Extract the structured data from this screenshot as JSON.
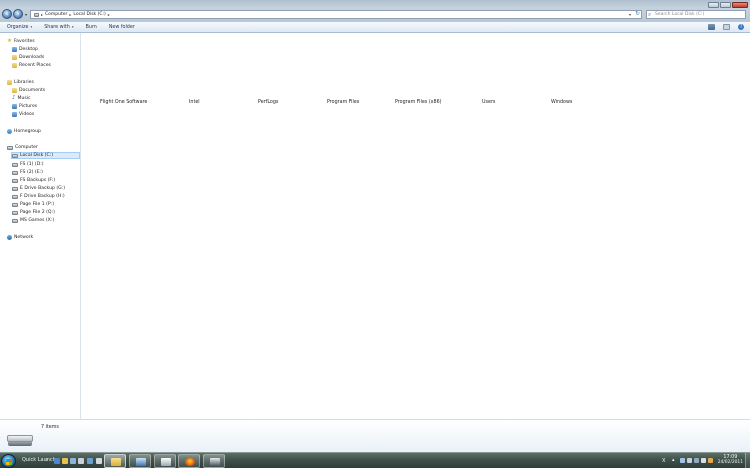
{
  "window": {
    "address": {
      "segments": [
        "Computer",
        "Local Disk (C:)"
      ]
    },
    "search_placeholder": "Search Local Disk (C:)"
  },
  "toolbar": {
    "organize": "Organize",
    "share_with": "Share with",
    "burn": "Burn",
    "new_folder": "New folder"
  },
  "navigation": {
    "favorites": {
      "label": "Favorites",
      "items": [
        "Desktop",
        "Downloads",
        "Recent Places"
      ]
    },
    "libraries": {
      "label": "Libraries",
      "items": [
        "Documents",
        "Music",
        "Pictures",
        "Videos"
      ]
    },
    "homegroup": "Homegroup",
    "computer": {
      "label": "Computer",
      "items": [
        "Local Disk (C:)",
        "FS (1) (D:)",
        "FS (2) (E:)",
        "FS Backups (F:)",
        "E Drive Backup (G:)",
        "F Drive Backup (H:)",
        "Page File 1 (P:)",
        "Page File 2 (Q:)",
        "MS Games (X:)"
      ],
      "selected": "Local Disk (C:)"
    },
    "network": "Network"
  },
  "files": [
    "Flight One Software",
    "Intel",
    "PerfLogs",
    "Program Files",
    "Program Files (x86)",
    "Users",
    "Windows"
  ],
  "details": {
    "item_count": "7 items"
  },
  "taskbar": {
    "quick_launch": "Quick Launch",
    "language": "X",
    "time": "17:09",
    "date": "24/02/2011"
  },
  "colors": {
    "selection_bg": "#dcebfc",
    "taskbar": "#3f514b",
    "commandbar": "#dde8f3"
  }
}
